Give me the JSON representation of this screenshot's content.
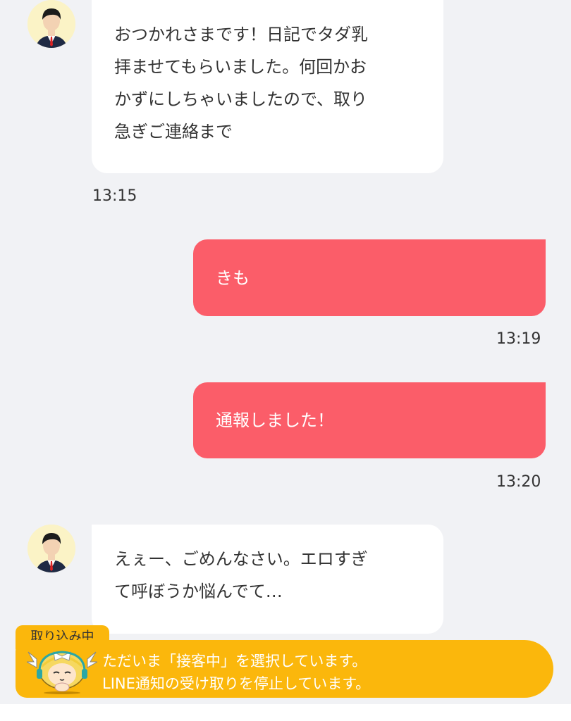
{
  "messages": [
    {
      "direction": "incoming",
      "text": "おつかれさまです！日記でタダ乳\n拝ませてもらいました。何回かお\nかずにしちゃいましたので、取り\n急ぎご連絡まで",
      "time": "13:15"
    },
    {
      "direction": "outgoing",
      "text": "きも",
      "time": "13:19"
    },
    {
      "direction": "outgoing",
      "text": "通報しました！",
      "time": "13:20"
    },
    {
      "direction": "incoming",
      "text": "えぇー、ごめんなさい。エロすぎ\nて呼ぼうか悩んでて…"
    }
  ],
  "banner": {
    "tab_label": "取り込み中",
    "line1": "ただいま「接客中」を選択しています。",
    "line2": "LINE通知の受け取りを停止しています。",
    "color": "#fbb70c"
  },
  "colors": {
    "background": "#f1f2f5",
    "outgoing_bubble": "#fb5d69",
    "incoming_bubble": "#ffffff",
    "avatar_bg": "#fbf3c6"
  },
  "icons": {
    "avatar": "user-avatar-icon",
    "mascot": "headset-mascot-icon"
  }
}
